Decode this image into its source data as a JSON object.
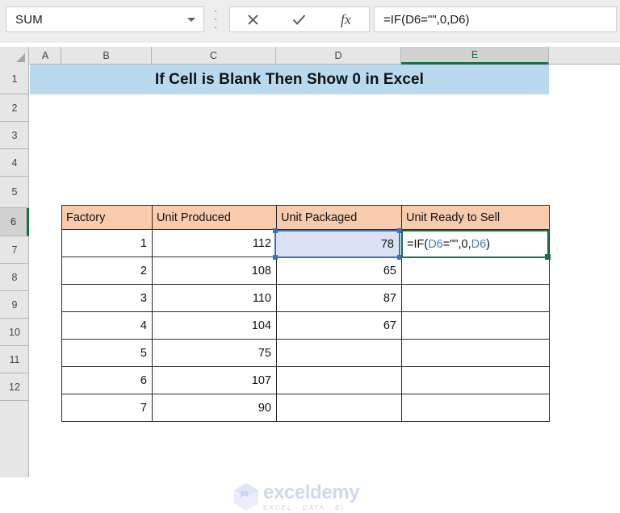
{
  "app": "excel",
  "formula_bar": {
    "name_box_value": "SUM",
    "name_box_icon": "chevron-down-icon",
    "kebab_icon": "more-options-icon",
    "cancel_icon": "cancel-x-icon",
    "enter_icon": "enter-check-icon",
    "insert_function_icon": "fx-icon",
    "insert_function_label": "fx",
    "formula_value": "=IF(D6=\"\",0,D6)"
  },
  "grid": {
    "columns": [
      "A",
      "B",
      "C",
      "D",
      "E"
    ],
    "active_column": "E",
    "rows": [
      "1",
      "2",
      "3",
      "4",
      "5",
      "6",
      "7",
      "8",
      "9",
      "10",
      "11",
      "12"
    ],
    "active_row": "6",
    "select_all_icon": "select-all-triangle-icon"
  },
  "title_banner": {
    "text": "If Cell is Blank Then Show 0 in Excel",
    "fill": "#B8D9EE"
  },
  "table": {
    "header_fill": "#F8CBAD",
    "headers": [
      "Factory",
      "Unit Produced",
      "Unit Packaged",
      "Unit Ready to Sell"
    ],
    "rows": [
      {
        "factory": "1",
        "produced": "112",
        "packaged": "78",
        "ready": ""
      },
      {
        "factory": "2",
        "produced": "108",
        "packaged": "65",
        "ready": ""
      },
      {
        "factory": "3",
        "produced": "110",
        "packaged": "87",
        "ready": ""
      },
      {
        "factory": "4",
        "produced": "104",
        "packaged": "67",
        "ready": ""
      },
      {
        "factory": "5",
        "produced": "75",
        "packaged": "",
        "ready": ""
      },
      {
        "factory": "6",
        "produced": "107",
        "packaged": "",
        "ready": ""
      },
      {
        "factory": "7",
        "produced": "90",
        "packaged": "",
        "ready": ""
      }
    ]
  },
  "referenced_cell": {
    "address": "D6",
    "value": "78",
    "highlight_fill": "#D9E2F3",
    "border_color": "#3B6FC4"
  },
  "active_cell": {
    "address": "E6",
    "border_color": "#1B7145",
    "formula_parts": {
      "prefix": "=IF(",
      "ref1": "D6",
      "middle": "=\"\",0,",
      "ref2": "D6",
      "suffix": ")"
    }
  },
  "watermark": {
    "name": "exceldemy",
    "tagline": "EXCEL · DATA · BI",
    "logo_icon": "exceldemy-logo-icon"
  }
}
